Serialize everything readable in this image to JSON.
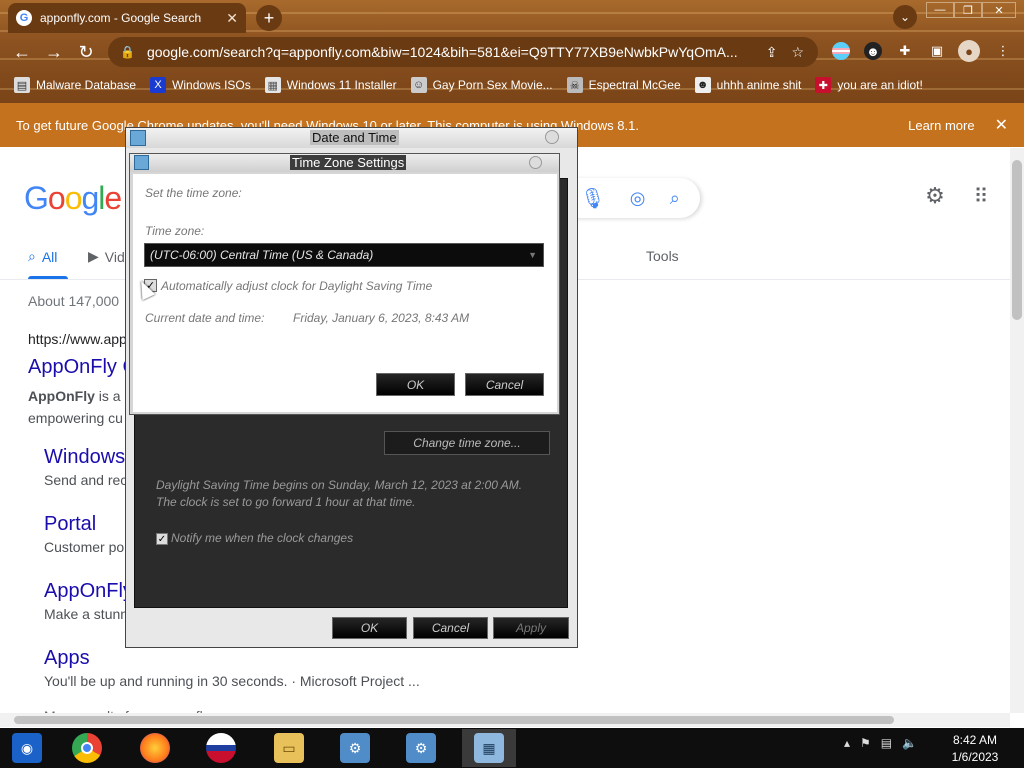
{
  "browser": {
    "tab_title": "apponfly.com - Google Search",
    "tab_close": "✕",
    "new_tab": "+",
    "url": "google.com/search?q=apponfly.com&biw=1024&bih=581&ei=Q9TTY77XB9eNwbkPwYqOmA...",
    "bookmarks": [
      {
        "label": "Malware Database",
        "icon": "document-icon"
      },
      {
        "label": "Windows ISOs",
        "icon": "x-logo-icon"
      },
      {
        "label": "Windows 11 Installer",
        "icon": "image-icon"
      },
      {
        "label": "Gay Porn Sex Movie...",
        "icon": "avatar-icon"
      },
      {
        "label": "Espectral McGee",
        "icon": "skull-icon"
      },
      {
        "label": "uhhh anime shit",
        "icon": "anime-icon"
      },
      {
        "label": "you are an idiot!",
        "icon": "flag-icon"
      }
    ],
    "infobar": {
      "message": "To get future Google Chrome updates, you'll need Windows 10 or later. This computer is using Windows 8.1.",
      "learn_more": "Learn more",
      "close": "✕"
    }
  },
  "google": {
    "logo": "Google",
    "tabs": {
      "all": "All",
      "videos": "Vid",
      "tools": "Tools"
    },
    "result_stats": "About 147,000",
    "results": {
      "url": "https://www.app",
      "title1": "AppOnFly C",
      "snippet1_bold": "AppOnFly",
      "snippet1_rest": " is a c",
      "snippet1_line2": "empowering cu",
      "sublinks": [
        {
          "title": "Windows",
          "snippet": "Send and rec"
        },
        {
          "title": "Portal",
          "snippet": "Customer po"
        },
        {
          "title": "AppOnFly",
          "snippet": "Make a stunn"
        },
        {
          "title": "Apps",
          "snippet": "You'll be up and running in 30 seconds. · Microsoft Project ..."
        }
      ],
      "more": "More results from apponfly..."
    }
  },
  "date_time_dialog": {
    "title": "Date and Time",
    "change_time_zone": "Change time zone...",
    "dst_line1": "Daylight Saving Time begins on Sunday, March 12, 2023 at 2:00 AM.",
    "dst_line2": "The clock is set to go forward 1 hour at that time.",
    "notify_label": "Notify me when the clock changes",
    "notify_checked": "✓",
    "ok": "OK",
    "cancel": "Cancel",
    "apply": "Apply"
  },
  "tz_dialog": {
    "title": "Time Zone Settings",
    "heading": "Set the time zone:",
    "tz_label": "Time zone:",
    "tz_value": "(UTC-06:00) Central Time (US & Canada)",
    "dst_checkbox_label": "Automatically adjust clock for Daylight Saving Time",
    "dst_checked": "✓",
    "current_label": "Current date and time:",
    "current_value": "Friday, January 6, 2023, 8:43 AM",
    "ok": "OK",
    "cancel": "Cancel"
  },
  "taskbar": {
    "clock_time": "8:42 AM",
    "clock_date": "1/6/2023"
  },
  "colors": {
    "link_blue": "#1a0dab",
    "google_blue": "#1a73e8",
    "infobar": "#c4721e"
  }
}
